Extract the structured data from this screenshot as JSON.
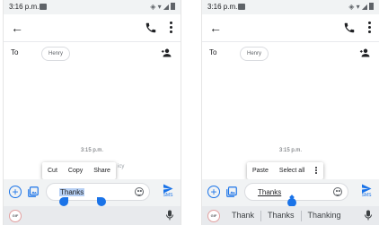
{
  "panels": [
    {
      "status_time": "3:16 p.m.",
      "to_label": "To",
      "recipient": "Henry",
      "timestamp": "3:15 p.m.",
      "context_menu": [
        "Cut",
        "Copy",
        "Share"
      ],
      "hidden_fragment": "icy",
      "compose_text": "Thanks",
      "send_label": "SMS",
      "gif_label": "GIF"
    },
    {
      "status_time": "3:16 p.m.",
      "to_label": "To",
      "recipient": "Henry",
      "timestamp": "3:15 p.m.",
      "context_menu": [
        "Paste",
        "Select all"
      ],
      "compose_text": "Thanks",
      "send_label": "SMS",
      "gif_label": "GIF",
      "suggestions": [
        "Thank",
        "Thanks",
        "Thanking"
      ]
    }
  ],
  "icons": {
    "back": "back-arrow-icon",
    "call": "phone-icon",
    "more": "more-vert-icon",
    "add_person": "add-person-icon",
    "plus": "plus-icon",
    "gallery": "gallery-icon",
    "emoji": "emoji-icon",
    "send": "send-icon",
    "mic": "mic-icon"
  },
  "colors": {
    "accent": "#1a73e8",
    "selection": "#b7d0f4",
    "composer_bg": "#f1f3f4",
    "keyboard_bg": "#e8eaed"
  }
}
